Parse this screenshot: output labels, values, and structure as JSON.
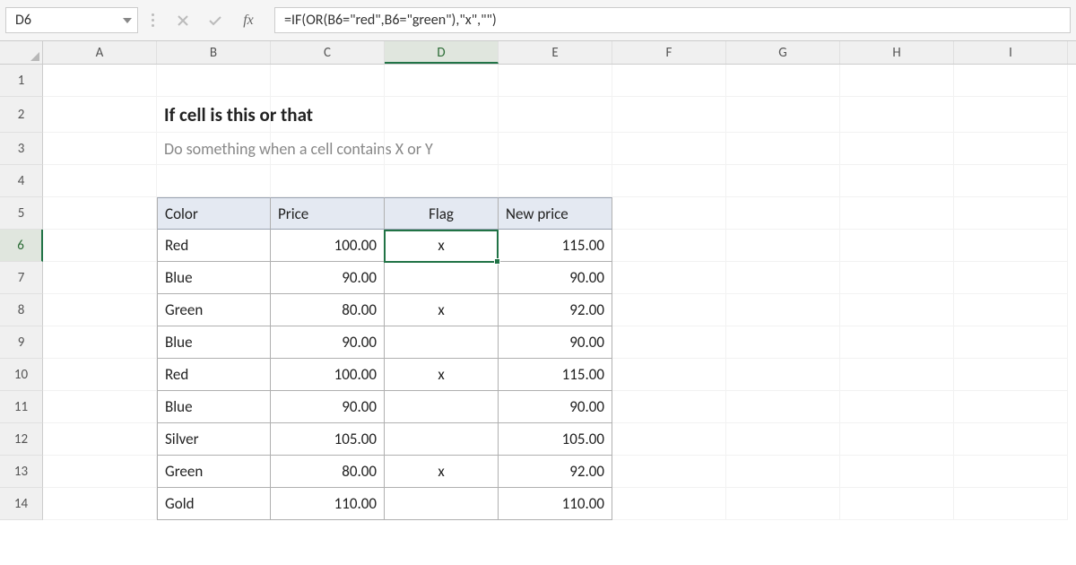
{
  "nameBox": "D6",
  "formula": "=IF(OR(B6=\"red\",B6=\"green\"),\"x\",\"\")",
  "fxLabel": "fx",
  "columns": [
    "A",
    "B",
    "C",
    "D",
    "E",
    "F",
    "G",
    "H",
    "I"
  ],
  "selectedCol": "D",
  "selectedRow": 6,
  "rowNumbers": [
    1,
    2,
    3,
    4,
    5,
    6,
    7,
    8,
    9,
    10,
    11,
    12,
    13,
    14
  ],
  "title": "If cell is this or that",
  "subtitle": "Do something when a cell contains X or Y",
  "table": {
    "headers": {
      "color": "Color",
      "price": "Price",
      "flag": "Flag",
      "newprice": "New price"
    },
    "rows": [
      {
        "color": "Red",
        "price": "100.00",
        "flag": "x",
        "newprice": "115.00"
      },
      {
        "color": "Blue",
        "price": "90.00",
        "flag": "",
        "newprice": "90.00"
      },
      {
        "color": "Green",
        "price": "80.00",
        "flag": "x",
        "newprice": "92.00"
      },
      {
        "color": "Blue",
        "price": "90.00",
        "flag": "",
        "newprice": "90.00"
      },
      {
        "color": "Red",
        "price": "100.00",
        "flag": "x",
        "newprice": "115.00"
      },
      {
        "color": "Blue",
        "price": "90.00",
        "flag": "",
        "newprice": "90.00"
      },
      {
        "color": "Silver",
        "price": "105.00",
        "flag": "",
        "newprice": "105.00"
      },
      {
        "color": "Green",
        "price": "80.00",
        "flag": "x",
        "newprice": "92.00"
      },
      {
        "color": "Gold",
        "price": "110.00",
        "flag": "",
        "newprice": "110.00"
      }
    ]
  },
  "chart_data": {
    "type": "table",
    "title": "If cell is this or that",
    "columns": [
      "Color",
      "Price",
      "Flag",
      "New price"
    ],
    "rows": [
      [
        "Red",
        100.0,
        "x",
        115.0
      ],
      [
        "Blue",
        90.0,
        "",
        90.0
      ],
      [
        "Green",
        80.0,
        "x",
        92.0
      ],
      [
        "Blue",
        90.0,
        "",
        90.0
      ],
      [
        "Red",
        100.0,
        "x",
        115.0
      ],
      [
        "Blue",
        90.0,
        "",
        90.0
      ],
      [
        "Silver",
        105.0,
        "",
        105.0
      ],
      [
        "Green",
        80.0,
        "x",
        92.0
      ],
      [
        "Gold",
        110.0,
        "",
        110.0
      ]
    ]
  }
}
